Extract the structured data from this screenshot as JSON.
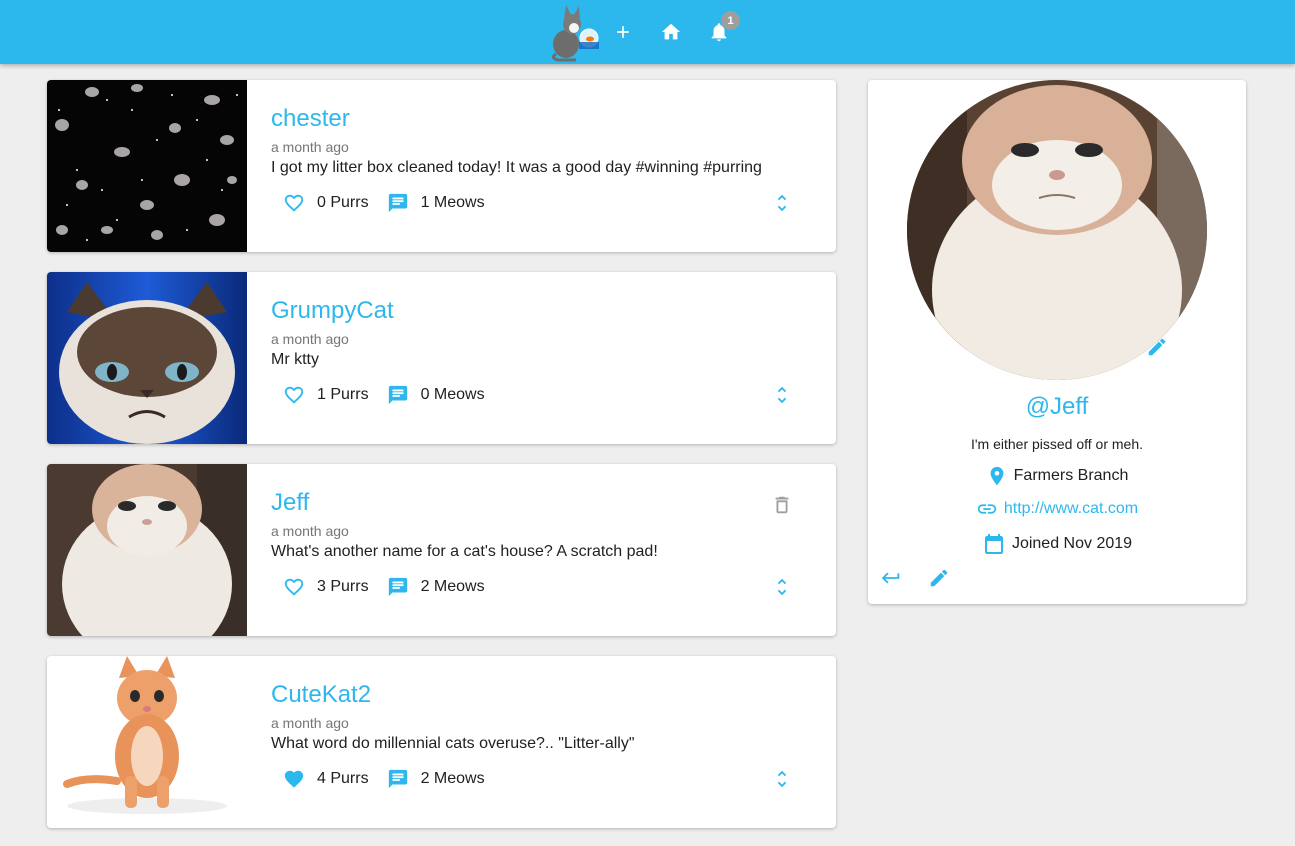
{
  "app": {
    "accent_color": "#2cb8ed",
    "notification_count": "1",
    "nav_icons": [
      "cat-logo",
      "add-icon",
      "home-icon",
      "bell-icon"
    ]
  },
  "posts": [
    {
      "author": "chester",
      "time": "a month ago",
      "body": "I got my litter box cleaned today! It was a good day #winning #purring",
      "purrs": "0 Purrs",
      "meows": "1 Meows",
      "liked": false,
      "deletable": false
    },
    {
      "author": "GrumpyCat",
      "time": "a month ago",
      "body": "Mr ktty",
      "purrs": "1 Purrs",
      "meows": "0 Meows",
      "liked": false,
      "deletable": false
    },
    {
      "author": "Jeff",
      "time": "a month ago",
      "body": "What's another name for a cat's house? A scratch pad!",
      "purrs": "3 Purrs",
      "meows": "2 Meows",
      "liked": false,
      "deletable": true
    },
    {
      "author": "CuteKat2",
      "time": "a month ago",
      "body": "What word do millennial cats overuse?.. \"Litter-ally\"",
      "purrs": "4 Purrs",
      "meows": "2 Meows",
      "liked": true,
      "deletable": false
    }
  ],
  "profile": {
    "handle": "@Jeff",
    "bio": "I'm either pissed off or meh.",
    "location": "Farmers Branch",
    "website": "http://www.cat.com",
    "joined": "Joined Nov 2019"
  }
}
